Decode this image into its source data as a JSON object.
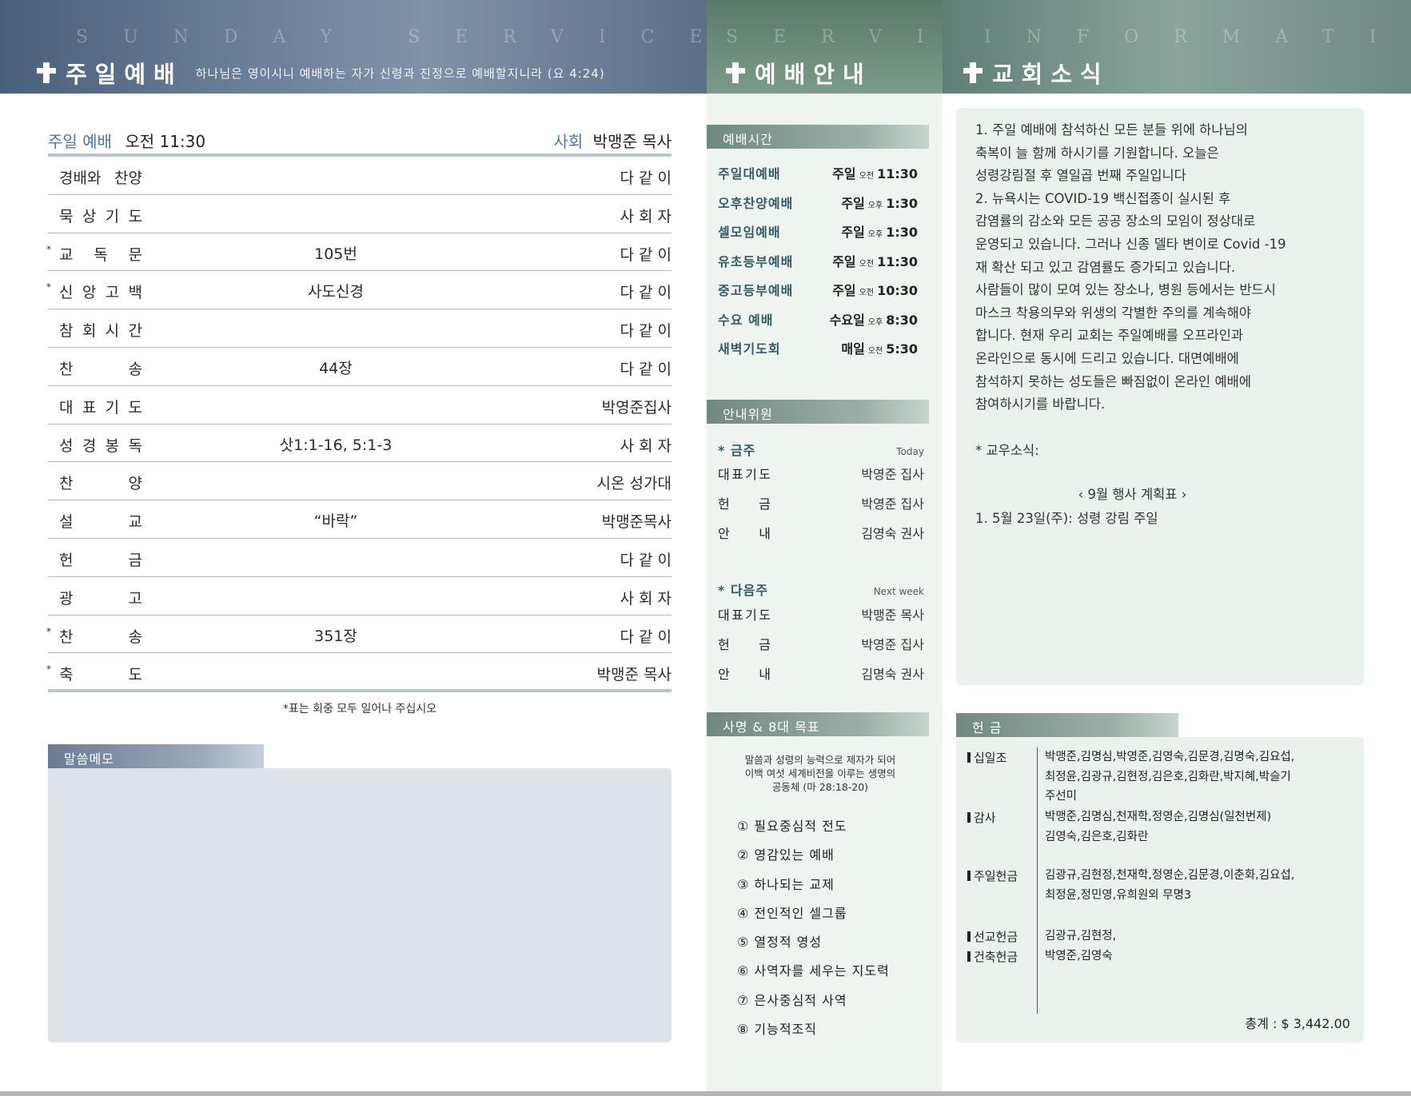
{
  "headers": {
    "sunday": {
      "watermark": "SUNDAY SERVICE",
      "title": "주일예배",
      "verse": "하나님은 영이시니 예배하는 자가 신령과 진정으로 예배할지니라 (요 4:24)"
    },
    "info": {
      "watermark": "SERVICE",
      "title": "예배안내"
    },
    "news": {
      "watermark": "INFORMATION",
      "title": "교회소식"
    }
  },
  "order": {
    "service_label": "주일 예배",
    "service_time": "오전 11:30",
    "host_label": "사회",
    "host_name": "박맹준 목사",
    "rows": [
      {
        "star": "",
        "item": "경배와 찬양",
        "detail": "",
        "who": "다 같 이"
      },
      {
        "star": "",
        "item": "묵 상 기 도",
        "detail": "",
        "who": "사 회 자"
      },
      {
        "star": "*",
        "item": "교 독 문",
        "detail": "105번",
        "who": "다 같 이"
      },
      {
        "star": "*",
        "item": "신 앙 고 백",
        "detail": "사도신경",
        "who": "다 같 이"
      },
      {
        "star": "",
        "item": "참 회 시 간",
        "detail": "",
        "who": "다 같 이"
      },
      {
        "star": "",
        "item": "찬 송",
        "detail": "44장",
        "who": "다 같 이"
      },
      {
        "star": "",
        "item": "대 표 기 도",
        "detail": "",
        "who": "박영준집사"
      },
      {
        "star": "",
        "item": "성 경 봉 독",
        "detail": "삿1:1-16, 5:1-3",
        "who": "사 회 자"
      },
      {
        "star": "",
        "item": "찬 양",
        "detail": "",
        "who": "시온 성가대"
      },
      {
        "star": "",
        "item": "설 교",
        "detail": "“바락”",
        "who": "박맹준목사"
      },
      {
        "star": "",
        "item": "헌 금",
        "detail": "",
        "who": "다 같 이"
      },
      {
        "star": "",
        "item": "광 고",
        "detail": "",
        "who": "사 회 자"
      },
      {
        "star": "*",
        "item": "찬 송",
        "detail": "351장",
        "who": "다 같 이"
      },
      {
        "star": "*",
        "item": "축 도",
        "detail": "",
        "who": "박맹준 목사"
      }
    ],
    "note": "*표는 회중 모두 일어나 주십시오"
  },
  "memo": {
    "label": "말씀메모"
  },
  "times": {
    "label": "예배시간",
    "rows": [
      {
        "name": "주일대예배",
        "day": "주일",
        "ampm": "오전",
        "time": "11:30"
      },
      {
        "name": "오후찬양예배",
        "day": "주일",
        "ampm": "오후",
        "time": "1:30"
      },
      {
        "name": "셀모임예배",
        "day": "주일",
        "ampm": "오후",
        "time": "1:30"
      },
      {
        "name": "유초등부예배",
        "day": "주일",
        "ampm": "오전",
        "time": "11:30"
      },
      {
        "name": "중고등부예배",
        "day": "주일",
        "ampm": "오전",
        "time": "10:30"
      },
      {
        "name": "수요 예배",
        "day": "수요일",
        "ampm": "오후",
        "time": "8:30"
      },
      {
        "name": "새벽기도회",
        "day": "매일",
        "ampm": "오전",
        "time": "5:30"
      }
    ]
  },
  "duty": {
    "label": "안내위원",
    "this_week": {
      "title": "* 금주",
      "sub": "Today",
      "rows": [
        {
          "role": "대표기도",
          "person": "박영준 집사"
        },
        {
          "role": "헌 금",
          "person": "박영준 집사"
        },
        {
          "role": "안 내",
          "person": "김영숙 권사"
        }
      ]
    },
    "next_week": {
      "title": "* 다음주",
      "sub": "Next week",
      "rows": [
        {
          "role": "대표기도",
          "person": "박맹준 목사"
        },
        {
          "role": "헌 금",
          "person": "박영준 집사"
        },
        {
          "role": "안 내",
          "person": "김명숙 권사"
        }
      ]
    }
  },
  "mission": {
    "label": "사명 & 8대 목표",
    "statement_lines": [
      "말씀과 성령의 능력으로 제자가 되어",
      "이백 여섯 세계비전을 이루는 생명의",
      "공동체 (마 28:18-20)"
    ],
    "goals": [
      "① 필요중심적 전도",
      "② 영감있는 예배",
      "③ 하나되는 교제",
      "④ 전인적인 셀그룹",
      "⑤ 열정적 영성",
      "⑥ 사역자를 세우는 지도력",
      "⑦ 은사중심적 사역",
      "⑧ 기능적조직"
    ]
  },
  "news": {
    "lines": [
      "1. 주일 예배에 참석하신 모든 분들 위에 하나님의",
      "축복이 늘 함께 하시기를 기원합니다. 오늘은",
      "성령강림절 후 열일곱 번째 주일입니다",
      "2. 뉴욕시는 COVID-19 백신접종이 실시된 후",
      "감염률의 감소와 모든 공공 장소의 모임이 정상대로",
      "운영되고 있습니다. 그러나 신종 델타 변이로 Covid -19",
      "재 확산 되고 있고 감염률도 증가되고 있습니다.",
      "사람들이 많이 모여 있는 장소나, 병원 등에서는 반드시",
      "마스크 착용의무와 위생의 각별한 주의를 계속해야",
      "합니다. 현재 우리 교회는 주일예배를 오프라인과",
      "온라인으로 동시에 드리고 있습니다. 대면예배에",
      "참석하지 못하는 성도들은 빠짐없이 온라인 예배에",
      "참여하시기를 바랍니다."
    ],
    "gyowoo": "* 교우소식:",
    "schedule_title": "‹ 9월 행사 계획표 ›",
    "schedule_item": "1. 5월 23일(주): 성령 강림 주일"
  },
  "offering": {
    "label": "헌 금",
    "tithe": {
      "cat": "십일조",
      "names": [
        "박맹준,김명심,박영준,김영숙,김문경,김명숙,김요섭,",
        "최정윤,김광규,김현정,김은호,김화란,박지혜,박슬기",
        "주선미"
      ]
    },
    "thanks": {
      "cat": "감사",
      "names": [
        "박맹준,김명심,천재학,정영순,김명심(일천번제)",
        "김영숙,김은호,김화란"
      ]
    },
    "sunday": {
      "cat": "주일헌금",
      "names": [
        "김광규,김현정,천재학,정영순,김문경,이춘화,김요섭,",
        "최정윤,정민영,유희원외 무명3"
      ]
    },
    "mission": {
      "cat": "선교헌금",
      "names": [
        "김광규,김현정,"
      ]
    },
    "building": {
      "cat": "건축헌금",
      "names": [
        "박영준,김영숙"
      ]
    },
    "total": "총계 : $ 3,442.00"
  }
}
